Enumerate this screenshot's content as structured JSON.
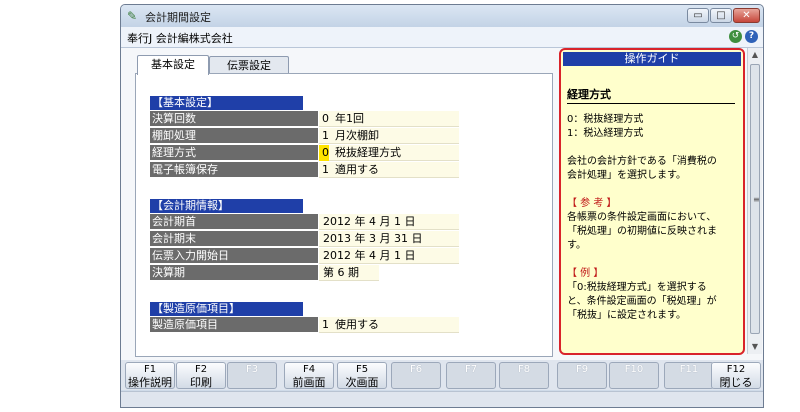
{
  "window": {
    "title": "会計期間設定",
    "company": "奉行J 会計編株式会社"
  },
  "window_controls": {
    "minimize": "▭",
    "maximize": "□",
    "close": "✕"
  },
  "tabs": [
    {
      "label": "基本設定"
    },
    {
      "label": "伝票設定"
    }
  ],
  "basic": {
    "heading": "【基本設定】",
    "rows": [
      {
        "label": "決算回数",
        "code": "0",
        "value": "年1回"
      },
      {
        "label": "棚卸処理",
        "code": "1",
        "value": "月次棚卸"
      },
      {
        "label": "経理方式",
        "code": "0",
        "value": "税抜経理方式"
      },
      {
        "label": "電子帳簿保存",
        "code": "1",
        "value": "適用する"
      }
    ]
  },
  "period": {
    "heading": "【会計期情報】",
    "rows": [
      {
        "label": "会計期首",
        "value": "2012 年  4 月  1 日"
      },
      {
        "label": "会計期末",
        "value": "2013 年  3 月 31 日"
      },
      {
        "label": "伝票入力開始日",
        "value": "2012 年  4 月  1 日"
      },
      {
        "label": "決算期",
        "value": "第   6 期"
      }
    ]
  },
  "manufacturing": {
    "heading": "【製造原価項目】",
    "rows": [
      {
        "label": "製造原価項目",
        "code": "1",
        "value": "使用する"
      }
    ]
  },
  "guide": {
    "header": "操作ガイド",
    "topic": "経理方式",
    "lines": [
      "0：税抜経理方式",
      "1：税込経理方式",
      "",
      "会社の会計方針である「消費税の",
      "会計処理」を選択します。",
      "",
      "【 参 考 】",
      "各帳票の条件設定画面において、",
      "「税処理」の初期値に反映されま",
      "す。",
      "",
      "【 例 】",
      "「0:税抜経理方式」を選択する",
      "と、条件設定画面の「税処理」が",
      "「税抜」に設定されます。"
    ]
  },
  "fkeys": [
    {
      "key": "F1",
      "label": "操作説明",
      "enabled": true
    },
    {
      "key": "F2",
      "label": "印刷",
      "enabled": true
    },
    {
      "key": "F3",
      "label": "",
      "enabled": false
    },
    {
      "key": "F4",
      "label": "前画面",
      "enabled": true
    },
    {
      "key": "F5",
      "label": "次画面",
      "enabled": true
    },
    {
      "key": "F6",
      "label": "",
      "enabled": false
    },
    {
      "key": "F7",
      "label": "",
      "enabled": false
    },
    {
      "key": "F8",
      "label": "",
      "enabled": false
    },
    {
      "key": "F9",
      "label": "",
      "enabled": false
    },
    {
      "key": "F10",
      "label": "",
      "enabled": false
    },
    {
      "key": "F11",
      "label": "",
      "enabled": false
    },
    {
      "key": "F12",
      "label": "閉じる",
      "enabled": true
    }
  ],
  "colors": {
    "section_header": "#1f3fa8",
    "label_bg": "#6b6b6b",
    "value_bg": "#fdfbe6",
    "guide_bg": "#ffffcc",
    "guide_border": "#d9232a",
    "highlight": "#ffe400"
  }
}
